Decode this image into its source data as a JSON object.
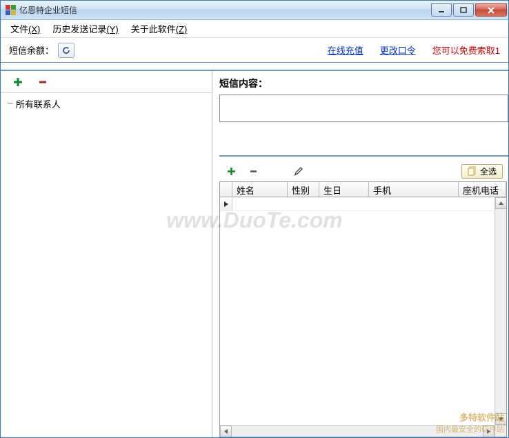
{
  "window": {
    "title": "亿恩特企业短信"
  },
  "menu": {
    "file": "文件",
    "file_accel": "(X)",
    "history": "历史发送记录",
    "history_accel": "(Y)",
    "about": "关于此软件",
    "about_accel": "(Z)"
  },
  "topbar": {
    "balance_label": "短信余额：",
    "recharge": "在线充值",
    "change_pwd": "更改口令",
    "free_prompt": "您可以免费索取1"
  },
  "contacts": {
    "root": "所有联系人"
  },
  "message": {
    "label": "短信内容：",
    "value": ""
  },
  "recipients": {
    "select_all": "全选",
    "columns": {
      "name": "姓名",
      "gender": "性别",
      "birthday": "生日",
      "mobile": "手机",
      "phone": "座机电话"
    },
    "widths": {
      "name": 80,
      "gender": 46,
      "birthday": 72,
      "mobile": 130,
      "phone": 120
    }
  },
  "watermark": "www.DuoTe.com",
  "badge": {
    "line1": "多特软件站",
    "line2": "国内最安全的软件站"
  },
  "icons": {
    "plus": "plus-icon",
    "minus": "minus-icon",
    "pencil": "pencil-icon",
    "refresh": "refresh-icon",
    "copy": "copy-icon"
  }
}
